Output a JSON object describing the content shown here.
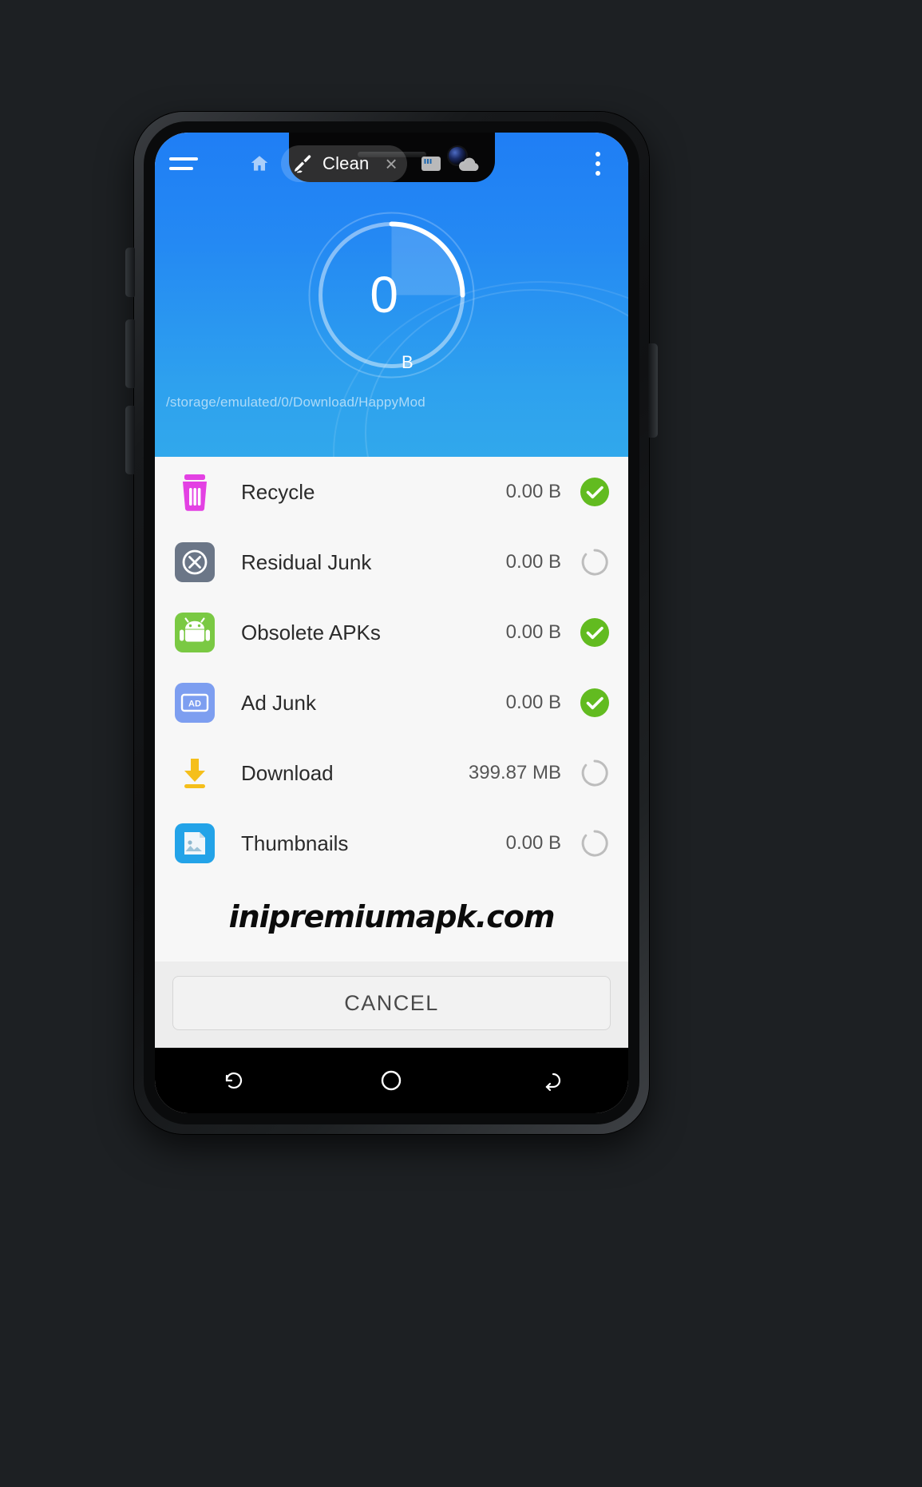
{
  "app": {
    "toolbar": {
      "menu_icon": "hamburger-menu-icon",
      "home_icon": "home-icon",
      "tab_icon": "broom-clean-icon",
      "tab_label": "Clean",
      "tab_close": "×",
      "icon_2": "sd-card-icon",
      "icon_3": "cloud-icon",
      "overflow_icon": "more-vertical-icon"
    },
    "gauge": {
      "value": "0",
      "unit": "B",
      "arc_percent": 25,
      "track_color": "#7fc0f7",
      "arc_color": "#ffffff"
    },
    "path": "/storage/emulated/0/Download/HappyMod",
    "header_gradient_top": "#1f7ef5",
    "header_gradient_bottom": "#31a8ec"
  },
  "list": {
    "rows": [
      {
        "icon": "trash-recycle-icon",
        "icon_color": "#e341e3",
        "name": "Recycle",
        "size": "0.00 B",
        "state": "check",
        "state_color": "#62bb20"
      },
      {
        "icon": "x-circle-icon",
        "icon_color": "#6b7687",
        "name": "Residual Junk",
        "size": "0.00 B",
        "state": "spinner",
        "state_color": "#b6b6b6"
      },
      {
        "icon": "android-apk-icon",
        "icon_color": "#7ac943",
        "name": "Obsolete APKs",
        "size": "0.00 B",
        "state": "check",
        "state_color": "#62bb20"
      },
      {
        "icon": "ad-banner-icon",
        "icon_color": "#7d9ef0",
        "name": "Ad Junk",
        "size": "0.00 B",
        "state": "check",
        "state_color": "#62bb20"
      },
      {
        "icon": "download-arrow-icon",
        "icon_color": "#f5bf1b",
        "name": "Download",
        "size": "399.87 MB",
        "state": "spinner",
        "state_color": "#b6b6b6"
      },
      {
        "icon": "thumbnail-image-icon",
        "icon_color": "#23a3e8",
        "name": "Thumbnails",
        "size": "0.00 B",
        "state": "spinner",
        "state_color": "#b6b6b6"
      }
    ]
  },
  "watermark": {
    "text": "inipremiumapk.com"
  },
  "footer": {
    "cancel_label": "CANCEL"
  },
  "navbar": {
    "recent_icon": "recents-icon",
    "home_icon": "home-circle-icon",
    "back_icon": "back-icon"
  }
}
